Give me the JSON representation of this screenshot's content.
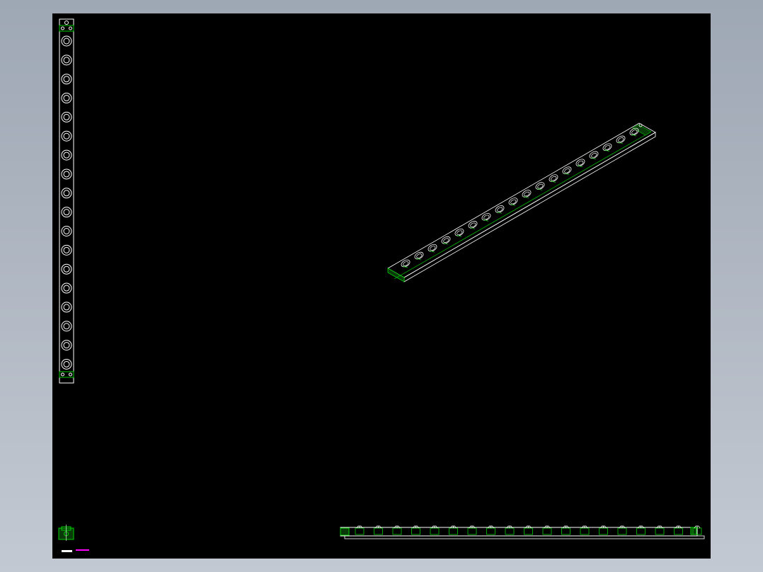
{
  "drawing": {
    "title_block_label": "",
    "title_block_note": "",
    "colors": {
      "outer_background": "#a3acb9",
      "canvas": "#000000",
      "line_white": "#ffffff",
      "line_green": "#00c800",
      "hatch_green": "#1a7a1a",
      "note_magenta": "#ff00ff"
    },
    "top_view": {
      "counterbore_count": 18
    },
    "isometric_view": {
      "counterbore_count": 18
    },
    "front_view": {
      "bolt_count": 19
    }
  }
}
